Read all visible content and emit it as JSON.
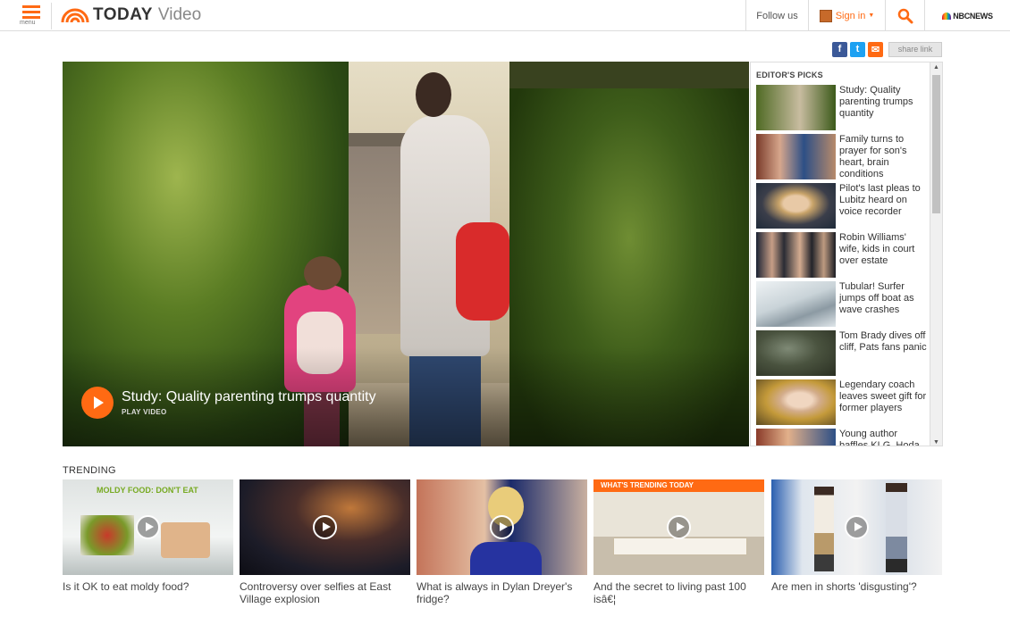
{
  "header": {
    "menu_label": "menu",
    "logo_today": "TODAY",
    "logo_video": "Video",
    "follow_label": "Follow us",
    "signin_label": "Sign in",
    "network_label": "NBCNEWS"
  },
  "share": {
    "facebook": "f",
    "twitter": "t",
    "email": "✉",
    "share_link_label": "share link"
  },
  "hero": {
    "title": "Study: Quality parenting trumps quantity",
    "subtitle": "PLAY VIDEO"
  },
  "editors_picks": {
    "title": "EDITOR'S PICKS",
    "items": [
      {
        "label": "Study: Quality parenting trumps quantity"
      },
      {
        "label": "Family turns to prayer for son's heart, brain conditions"
      },
      {
        "label": "Pilot's last pleas to Lubitz heard on voice recorder"
      },
      {
        "label": "Robin Williams' wife, kids in court over estate"
      },
      {
        "label": "Tubular! Surfer jumps off boat as wave crashes"
      },
      {
        "label": "Tom Brady dives off cliff, Pats fans panic"
      },
      {
        "label": "Legendary coach leaves sweet gift for former players"
      },
      {
        "label": "Young author baffles KLG, Hoda"
      }
    ]
  },
  "trending": {
    "title": "TRENDING",
    "items": [
      {
        "label": "Is it OK to eat moldy food?",
        "overlay": "MOLDY FOOD: DON'T EAT"
      },
      {
        "label": "Controversy over selfies at East Village explosion"
      },
      {
        "label": "What is always in Dylan Dreyer's fridge?"
      },
      {
        "label": "And the secret to living past 100 isâ€¦",
        "overlay": "WHAT'S TRENDING TODAY"
      },
      {
        "label": "Are men in shorts 'disgusting'?"
      }
    ]
  },
  "colors": {
    "accent": "#ff6a13",
    "facebook": "#3b5998",
    "twitter": "#1da1f2"
  }
}
